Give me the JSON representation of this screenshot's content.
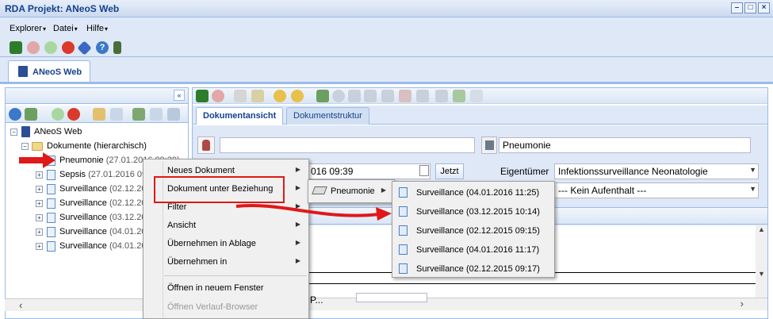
{
  "window": {
    "title": "RDA Projekt: ANeoS Web"
  },
  "menubar": {
    "items": [
      "Explorer",
      "Datei",
      "Hilfe"
    ]
  },
  "app_tab": {
    "label": "ANeoS Web"
  },
  "left_panel": {
    "collapse_symbol": "«",
    "tree": {
      "root": "ANeoS Web",
      "folder": "Dokumente (hierarchisch)",
      "items": [
        {
          "name": "Pneumonie",
          "date": "(27.01.2016 09:39)"
        },
        {
          "name": "Sepsis",
          "date": "(27.01.2016 09:"
        },
        {
          "name": "Surveillance",
          "date": "(02.12.20"
        },
        {
          "name": "Surveillance",
          "date": "(02.12.20"
        },
        {
          "name": "Surveillance",
          "date": "(03.12.20"
        },
        {
          "name": "Surveillance",
          "date": "(04.01.20"
        },
        {
          "name": "Surveillance",
          "date": "(04.01.20"
        }
      ]
    }
  },
  "right_panel": {
    "tabs": [
      "Dokumentansicht",
      "Dokumentstruktur"
    ],
    "title_field": "Pneumonie",
    "date_field": "016 09:39",
    "jetzt_button": "Jetzt",
    "owner_label": "Eigentümer",
    "owner_value": "Infektionssurveillance Neonatologie",
    "stay_value": "--- Kein Aufenthalt ---",
    "partial_label": "P..."
  },
  "context_menu": {
    "items": [
      {
        "label": "Neues Dokument",
        "submenu": true,
        "disabled": false
      },
      {
        "label": "Dokument unter Beziehung",
        "submenu": true,
        "disabled": false
      },
      {
        "label": "Filter",
        "submenu": true,
        "disabled": false
      },
      {
        "label": "Ansicht",
        "submenu": true,
        "disabled": false
      },
      {
        "label": "Übernehmen in Ablage",
        "submenu": true,
        "disabled": false
      },
      {
        "label": "Übernehmen in",
        "submenu": true,
        "disabled": false
      },
      {
        "label": "Öffnen in neuem Fenster",
        "submenu": false,
        "disabled": false
      },
      {
        "label": "Öffnen Verlauf-Browser",
        "submenu": false,
        "disabled": true
      }
    ]
  },
  "submenu1": {
    "label": "Pneumonie"
  },
  "submenu2": {
    "items": [
      "Surveillance (04.01.2016 11:25)",
      "Surveillance (03.12.2015 10:14)",
      "Surveillance (02.12.2015 09:15)",
      "Surveillance (04.01.2016 11:17)",
      "Surveillance (02.12.2015 09:17)"
    ]
  },
  "colors": {
    "accent": "#15428b",
    "highlight": "#e01818",
    "panel": "#dfe8f6"
  }
}
